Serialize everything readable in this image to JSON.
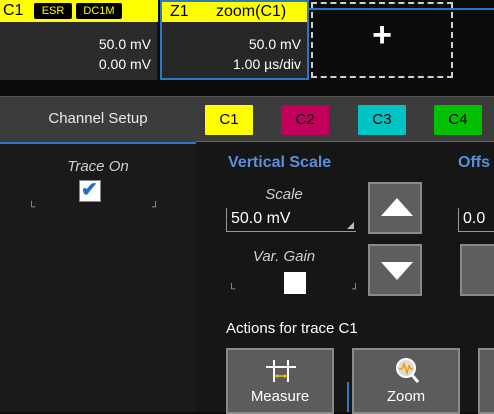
{
  "trace_descriptors": {
    "c1": {
      "label": "C1",
      "tags": [
        "ESR",
        "DC1M"
      ],
      "vertical": "50.0 mV",
      "offset": "0.00 mV",
      "color": "#ffff00"
    },
    "z1": {
      "label": "Z1",
      "name": "zoom(C1)",
      "vertical": "50.0 mV",
      "timebase": "1.00 µs/div",
      "color": "#ffff00"
    },
    "add_slot_symbol": "+"
  },
  "tabs": {
    "setup_label": "Channel Setup",
    "channels": [
      {
        "label": "C1",
        "color": "#ffff00"
      },
      {
        "label": "C2",
        "color": "#c0005c"
      },
      {
        "label": "C3",
        "color": "#00c4c4"
      },
      {
        "label": "C4",
        "color": "#00c000"
      }
    ]
  },
  "left": {
    "trace_on_label": "Trace On",
    "trace_on_checked": true
  },
  "vertical_scale": {
    "title": "Vertical Scale",
    "scale_label": "Scale",
    "scale_value": "50.0 mV",
    "var_gain_label": "Var. Gain",
    "var_gain_checked": false
  },
  "offset": {
    "title": "Offs",
    "value": "0.0"
  },
  "actions": {
    "label": "Actions for trace C1",
    "buttons": [
      {
        "label": "Measure",
        "icon": "measure-icon"
      },
      {
        "label": "Zoom",
        "icon": "zoom-icon"
      }
    ]
  },
  "colors": {
    "accent": "#2a78c4",
    "section_title": "#5a8fd8"
  }
}
